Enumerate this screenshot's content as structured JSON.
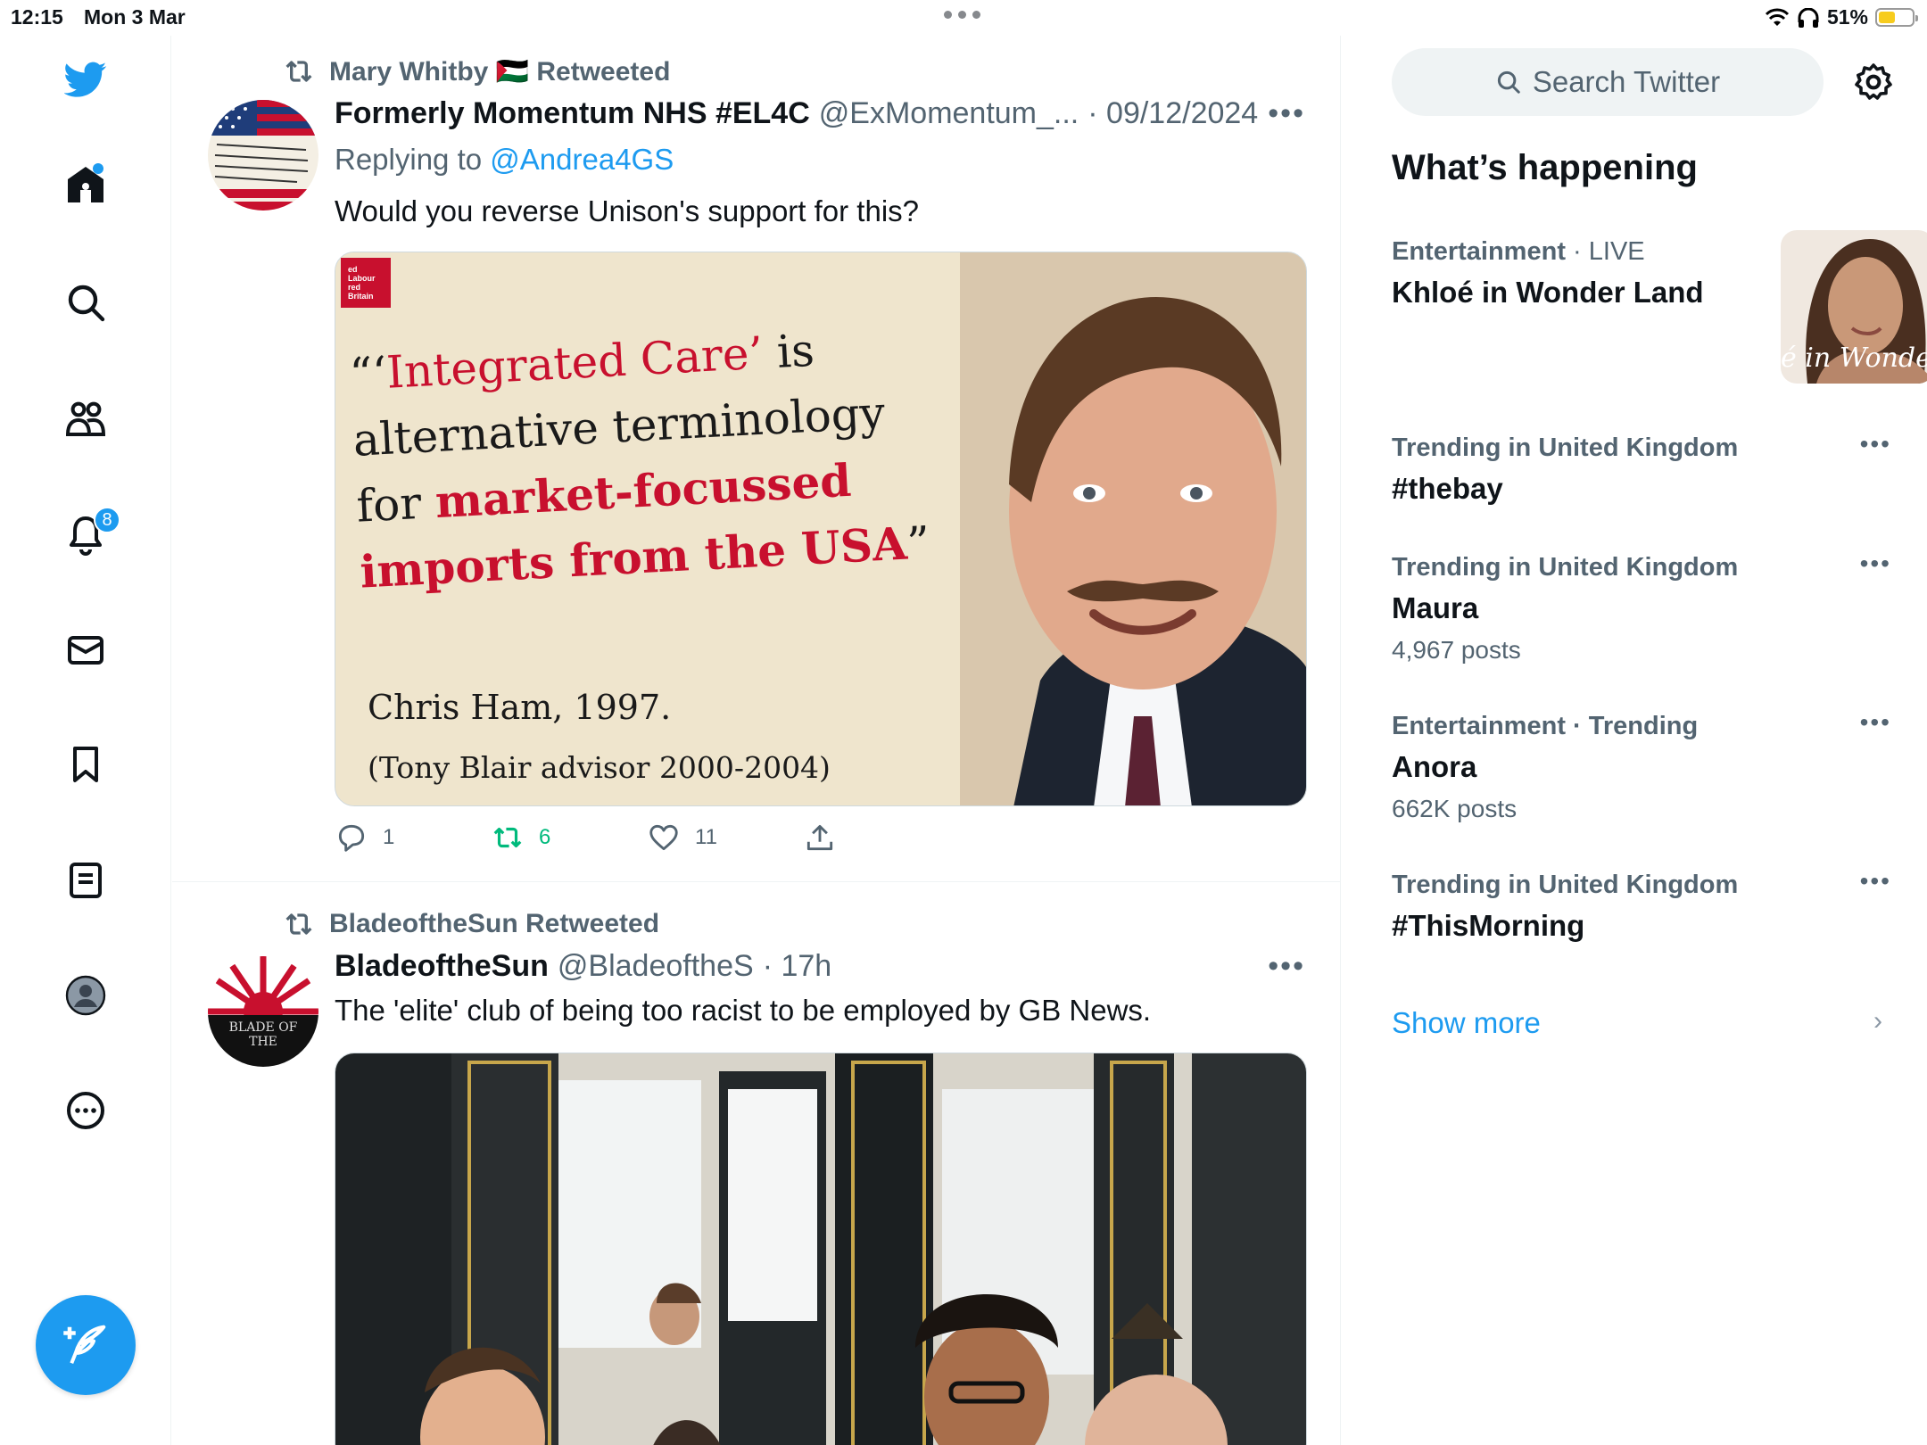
{
  "status": {
    "time": "12:15",
    "date": "Mon 3 Mar",
    "battery": "51%",
    "battery_level": 0.51
  },
  "nav": {
    "notifications_badge": "8",
    "items": [
      "twitter-logo",
      "home-icon",
      "search-icon",
      "communities-icon",
      "notifications-icon",
      "messages-icon",
      "bookmarks-icon",
      "lists-icon",
      "profile-icon",
      "more-icon"
    ]
  },
  "tweets": [
    {
      "retweeted_by": "Mary Whitby 🇵🇸 Retweeted",
      "display_name": "Formerly Momentum NHS #EL4C",
      "handle": "@ExMomentum_...",
      "time": "· 09/12/2024",
      "reply_prefix": "Replying to",
      "reply_to": "@Andrea4GS",
      "text": "Would you reverse Unison's support for this?",
      "media": {
        "quote_open": "“‘",
        "quote_red1": "Integrated Care’",
        "quote_black1": " is",
        "quote_line2": "alternative terminology",
        "quote_for": "for ",
        "quote_red2": "market-focussed",
        "quote_red3": "imports from the USA",
        "quote_close": "”",
        "attribution": "Chris Ham, 1997.",
        "role": "(Tony Blair advisor 2000-2004)",
        "logo_text": "ed Labour\nred Britain"
      },
      "replies": "1",
      "retweets": "6",
      "likes": "11"
    },
    {
      "retweeted_by": "BladeoftheSun Retweeted",
      "display_name": "BladeoftheSun",
      "handle": "@BladeoftheS",
      "time": "· 17h",
      "text": "The 'elite' club of being too racist to be employed by GB News.",
      "avatar_text": "BLADE OF THE"
    }
  ],
  "sidebar": {
    "search_placeholder": "Search Twitter",
    "heading": "What’s happening",
    "trends": [
      {
        "category": "Entertainment",
        "sep": " · ",
        "status": "LIVE",
        "title": "Khloé in Wonder Land",
        "image_caption": "é in Wonder L"
      },
      {
        "category": "Trending in United Kingdom",
        "title": "#thebay"
      },
      {
        "category": "Trending in United Kingdom",
        "title": "Maura",
        "count": "4,967 posts"
      },
      {
        "category": "Entertainment · Trending",
        "title": "Anora",
        "count": "662K posts"
      },
      {
        "category": "Trending in United Kingdom",
        "title": "#ThisMorning"
      }
    ],
    "show_more": "Show more"
  },
  "colors": {
    "accent": "#1d9bf0",
    "retweet_green": "#00ba7c",
    "secondary_text": "#536471"
  }
}
